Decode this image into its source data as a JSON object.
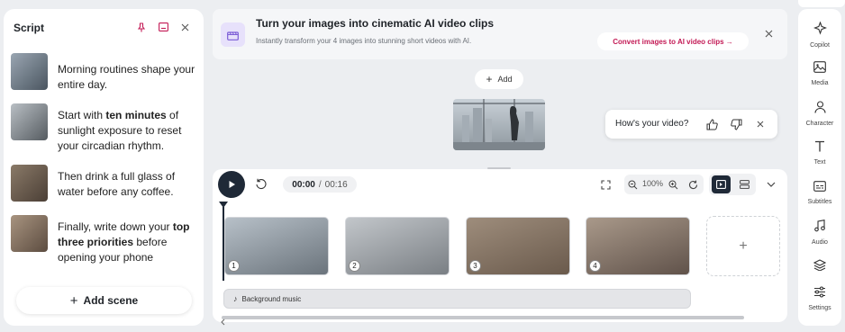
{
  "script_panel": {
    "title": "Script",
    "icons": [
      "pin-icon",
      "panel-icon",
      "close-icon"
    ],
    "scenes": [
      {
        "parts": [
          {
            "text": "Morning routines shape your entire day.",
            "bold": false
          }
        ],
        "thumb_colors": [
          "#9aa6b2",
          "#4a5560"
        ]
      },
      {
        "parts": [
          {
            "text": "Start with ",
            "bold": false
          },
          {
            "text": "ten minutes",
            "bold": true
          },
          {
            "text": " of sunlight exposure to reset your circadian rhythm.",
            "bold": false
          }
        ],
        "thumb_colors": [
          "#b9bfc4",
          "#555b60"
        ]
      },
      {
        "parts": [
          {
            "text": "Then drink a full glass of water before any coffee.",
            "bold": false
          }
        ],
        "thumb_colors": [
          "#8a7a68",
          "#4b3f36"
        ]
      },
      {
        "parts": [
          {
            "text": "Finally, write down your ",
            "bold": false
          },
          {
            "text": "top three priorities",
            "bold": true
          },
          {
            "text": " before opening your phone",
            "bold": false
          }
        ],
        "thumb_colors": [
          "#a89480",
          "#5c4c40"
        ]
      }
    ],
    "add_scene_label": "Add scene"
  },
  "promo": {
    "title": "Turn your images into cinematic AI video clips",
    "subtitle": "Instantly transform your 4 images into stunning short videos with AI.",
    "cta_label": "Convert images to AI video clips →",
    "accent": "#c31a55"
  },
  "canvas": {
    "add_label": "Add",
    "feedback_question": "How's your video?"
  },
  "timeline": {
    "current_time": "00:00",
    "separator": "/",
    "total_time": "00:16",
    "zoom": "100%",
    "clips": [
      {
        "number": "1",
        "colors": [
          "#b7c0c8",
          "#6b747c"
        ]
      },
      {
        "number": "2",
        "colors": [
          "#c2c6ca",
          "#7a7f84"
        ]
      },
      {
        "number": "3",
        "colors": [
          "#9e8d7c",
          "#6a5a4c"
        ]
      },
      {
        "number": "4",
        "colors": [
          "#a9998a",
          "#60524a"
        ]
      }
    ],
    "add_clip_label": "+",
    "music_label": "Background music"
  },
  "sidebar": {
    "items": [
      {
        "label": "Copilot",
        "icon": "sparkle-icon"
      },
      {
        "label": "Media",
        "icon": "image-icon"
      },
      {
        "label": "Character",
        "icon": "person-icon"
      },
      {
        "label": "Text",
        "icon": "text-icon"
      },
      {
        "label": "Subtitles",
        "icon": "subtitles-icon"
      },
      {
        "label": "Audio",
        "icon": "music-icon"
      },
      {
        "label": "",
        "icon": "layers-icon"
      },
      {
        "label": "Settings",
        "icon": "sliders-icon"
      }
    ]
  }
}
